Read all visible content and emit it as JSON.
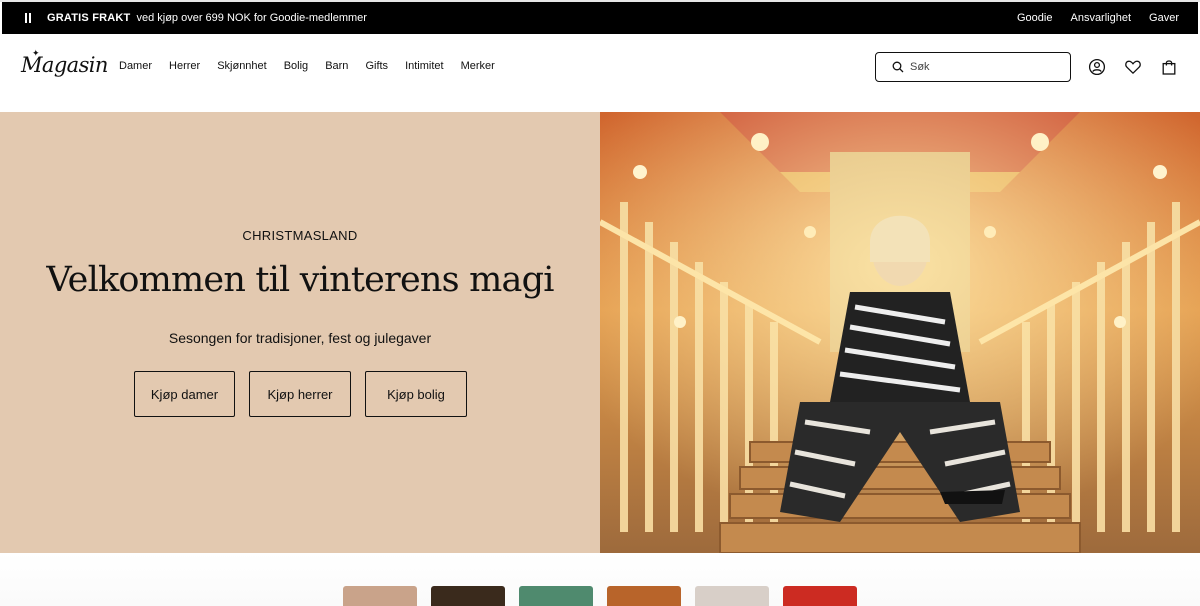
{
  "announcement": {
    "bold": "GRATIS FRAKT",
    "text": "ved kjøp over 699 NOK for Goodie-medlemmer",
    "links": [
      "Goodie",
      "Ansvarlighet",
      "Gaver"
    ]
  },
  "header": {
    "logo": "Magasin",
    "nav": [
      "Damer",
      "Herrer",
      "Skjønnhet",
      "Bolig",
      "Barn",
      "Gifts",
      "Intimitet",
      "Merker"
    ],
    "search_placeholder": "Søk",
    "icons": [
      "account-icon",
      "heart-icon",
      "bag-icon"
    ]
  },
  "hero": {
    "eyebrow": "CHRISTMASLAND",
    "headline": "Velkommen til vinterens magi",
    "subheading": "Sesongen for tradisjoner, fest og julegaver",
    "buttons": [
      "Kjøp damer",
      "Kjøp herrer",
      "Kjøp bolig"
    ],
    "panel_color": "#e3c9b0"
  },
  "category_tiles": [
    {
      "color": "#c9a38a"
    },
    {
      "color": "#3a2a1c"
    },
    {
      "color": "#4f8a6e"
    },
    {
      "color": "#b8642a"
    },
    {
      "color": "#d8cfc8"
    },
    {
      "color": "#cc2b22"
    }
  ]
}
